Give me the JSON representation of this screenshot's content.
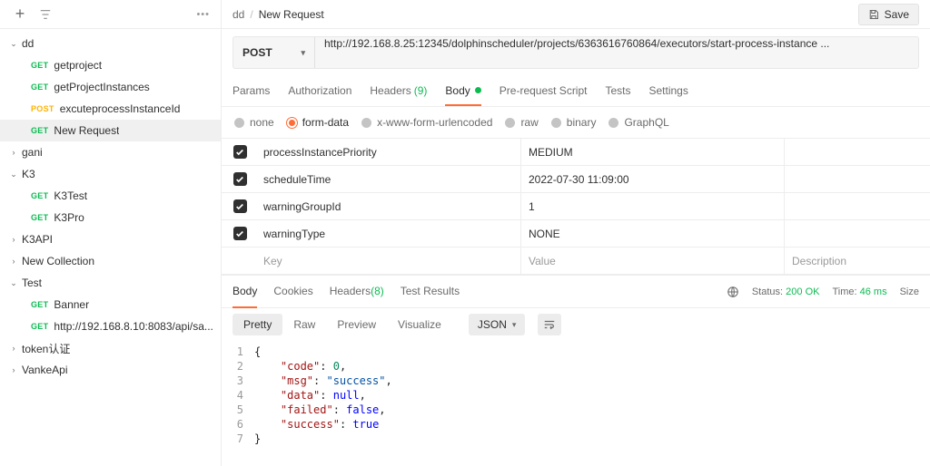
{
  "sidebar": {
    "collections": [
      {
        "type": "col",
        "name": "dd",
        "open": true,
        "items": [
          {
            "method": "GET",
            "label": "getproject"
          },
          {
            "method": "GET",
            "label": "getProjectInstances"
          },
          {
            "method": "POST",
            "label": "excuteprocessInstanceId"
          },
          {
            "method": "GET",
            "label": "New Request",
            "active": true
          }
        ]
      },
      {
        "type": "col",
        "name": "gani",
        "open": false
      },
      {
        "type": "col",
        "name": "K3",
        "open": true,
        "items": [
          {
            "method": "GET",
            "label": "K3Test"
          },
          {
            "method": "GET",
            "label": "K3Pro"
          }
        ]
      },
      {
        "type": "col",
        "name": "K3API",
        "open": false
      },
      {
        "type": "col",
        "name": "New Collection",
        "open": false
      },
      {
        "type": "col",
        "name": "Test",
        "open": true,
        "items": [
          {
            "method": "GET",
            "label": "Banner"
          },
          {
            "method": "GET",
            "label": "http://192.168.8.10:8083/api/sa..."
          }
        ]
      },
      {
        "type": "col",
        "name": "token认证",
        "open": false
      },
      {
        "type": "col",
        "name": "VankeApi",
        "open": false
      }
    ]
  },
  "breadcrumb": {
    "parent": "dd",
    "current": "New Request"
  },
  "save_label": "Save",
  "request": {
    "method": "POST",
    "url": "http://192.168.8.25:12345/dolphinscheduler/projects/6363616760864/executors/start-process-instance ..."
  },
  "req_tabs": {
    "params": "Params",
    "auth": "Authorization",
    "headers": "Headers",
    "headers_count": "(9)",
    "body": "Body",
    "prereq": "Pre-request Script",
    "tests": "Tests",
    "settings": "Settings"
  },
  "body_types": {
    "none": "none",
    "formdata": "form-data",
    "urlenc": "x-www-form-urlencoded",
    "raw": "raw",
    "binary": "binary",
    "graphql": "GraphQL"
  },
  "kv_rows": [
    {
      "key": "processInstancePriority",
      "value": "MEDIUM"
    },
    {
      "key": "scheduleTime",
      "value": "2022-07-30 11:09:00"
    },
    {
      "key": "warningGroupId",
      "value": "1"
    },
    {
      "key": "warningType",
      "value": "NONE"
    }
  ],
  "kv_placeholder": {
    "key": "Key",
    "value": "Value",
    "desc": "Description"
  },
  "resp_tabs": {
    "body": "Body",
    "cookies": "Cookies",
    "headers": "Headers",
    "headers_count": "(8)",
    "tests": "Test Results"
  },
  "resp_meta": {
    "status_lbl": "Status:",
    "status_val": "200 OK",
    "time_lbl": "Time:",
    "time_val": "46 ms",
    "size_lbl": "Size"
  },
  "view_modes": {
    "pretty": "Pretty",
    "raw": "Raw",
    "preview": "Preview",
    "visualize": "Visualize"
  },
  "lang": "JSON",
  "response_json": [
    {
      "indent": 0,
      "tokens": [
        {
          "t": "punc",
          "v": "{"
        }
      ]
    },
    {
      "indent": 1,
      "tokens": [
        {
          "t": "key",
          "v": "\"code\""
        },
        {
          "t": "punc",
          "v": ": "
        },
        {
          "t": "num",
          "v": "0"
        },
        {
          "t": "punc",
          "v": ","
        }
      ]
    },
    {
      "indent": 1,
      "tokens": [
        {
          "t": "key",
          "v": "\"msg\""
        },
        {
          "t": "punc",
          "v": ": "
        },
        {
          "t": "str",
          "v": "\"success\""
        },
        {
          "t": "punc",
          "v": ","
        }
      ]
    },
    {
      "indent": 1,
      "tokens": [
        {
          "t": "key",
          "v": "\"data\""
        },
        {
          "t": "punc",
          "v": ": "
        },
        {
          "t": "null",
          "v": "null"
        },
        {
          "t": "punc",
          "v": ","
        }
      ]
    },
    {
      "indent": 1,
      "tokens": [
        {
          "t": "key",
          "v": "\"failed\""
        },
        {
          "t": "punc",
          "v": ": "
        },
        {
          "t": "bool",
          "v": "false"
        },
        {
          "t": "punc",
          "v": ","
        }
      ]
    },
    {
      "indent": 1,
      "tokens": [
        {
          "t": "key",
          "v": "\"success\""
        },
        {
          "t": "punc",
          "v": ": "
        },
        {
          "t": "bool",
          "v": "true"
        }
      ]
    },
    {
      "indent": 0,
      "tokens": [
        {
          "t": "punc",
          "v": "}"
        }
      ]
    }
  ]
}
